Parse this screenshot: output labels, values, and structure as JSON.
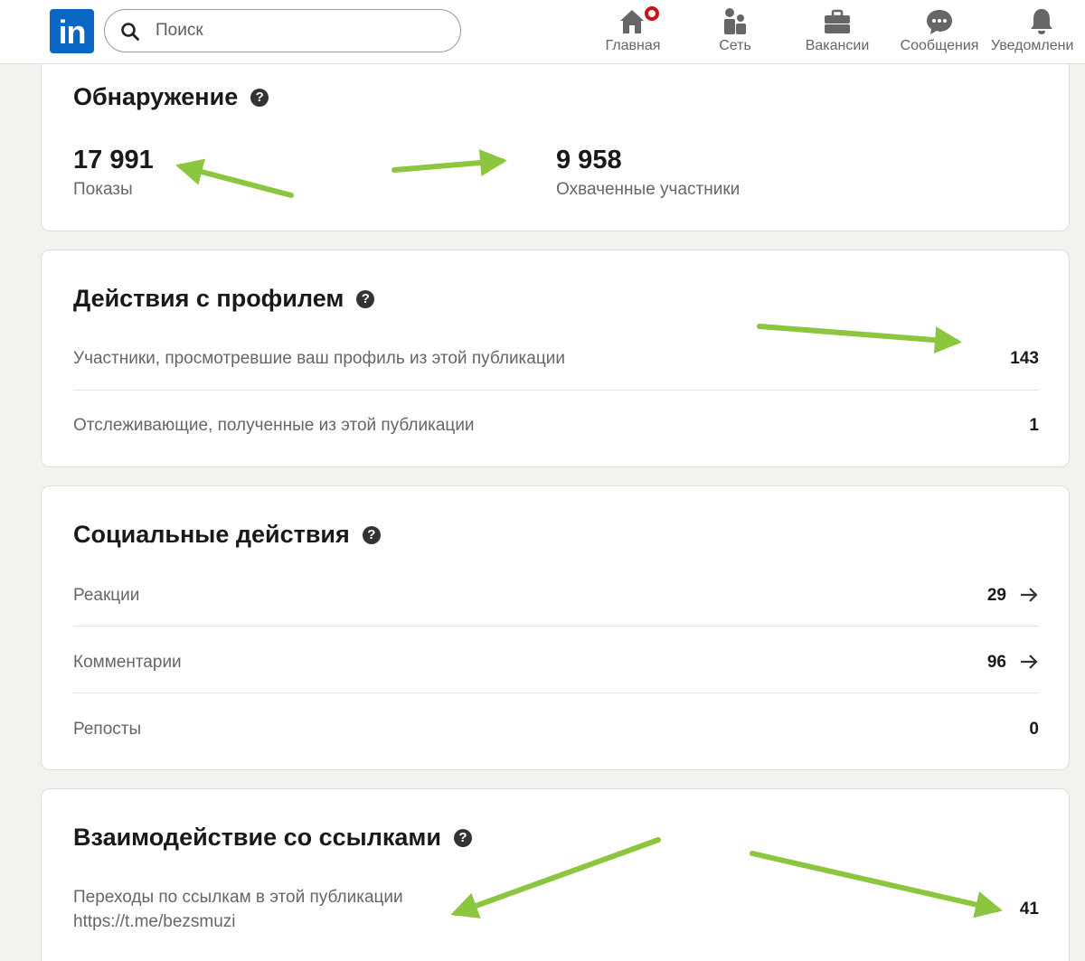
{
  "header": {
    "logo_text": "in",
    "search_placeholder": "Поиск",
    "nav": [
      {
        "label": "Главная",
        "icon": "home-icon"
      },
      {
        "label": "Сеть",
        "icon": "network-icon"
      },
      {
        "label": "Вакансии",
        "icon": "briefcase-icon"
      },
      {
        "label": "Сообщения",
        "icon": "messaging-icon"
      },
      {
        "label": "Уведомлени",
        "icon": "bell-icon"
      }
    ]
  },
  "discovery": {
    "title": "Обнаружение",
    "help": "?",
    "impressions_value": "17 991",
    "impressions_label": "Показы",
    "reached_value": "9 958",
    "reached_label": "Охваченные участники"
  },
  "profile_activity": {
    "title": "Действия с профилем",
    "help": "?",
    "rows": [
      {
        "label": "Участники, просмотревшие ваш профиль из этой публикации",
        "value": "143"
      },
      {
        "label": "Отслеживающие, полученные из этой публикации",
        "value": "1"
      }
    ]
  },
  "social": {
    "title": "Социальные действия",
    "help": "?",
    "rows": [
      {
        "label": "Реакции",
        "value": "29"
      },
      {
        "label": "Комментарии",
        "value": "96"
      },
      {
        "label": "Репосты",
        "value": "0"
      }
    ]
  },
  "links": {
    "title": "Взаимодействие со ссылками",
    "help": "?",
    "row_label": "Переходы по ссылкам в этой публикации",
    "row_url": "https://t.me/bezsmuzi",
    "row_value": "41"
  },
  "colors": {
    "linkedin_blue": "#0a66c2",
    "notification_red": "#cc1016",
    "annotation_green": "#8cc63f",
    "page_background": "#f3f2ef"
  }
}
